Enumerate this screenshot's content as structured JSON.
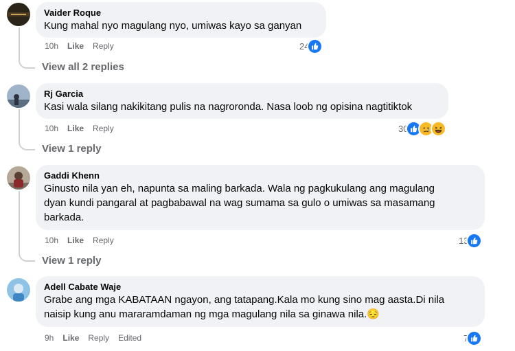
{
  "comments": [
    {
      "author": "Vaider Roque",
      "lines": [
        "Kung mahal nyo magulang nyo, umiwas kayo sa ganyan"
      ],
      "time": "10h",
      "like": "Like",
      "reply": "Reply",
      "reaction_count": "24",
      "reactions": [
        "like-icon"
      ],
      "view_replies": "View all 2 replies"
    },
    {
      "author": "Rj Garcia",
      "lines": [
        "Kasi wala silang nakikitang pulis na nagroronda. Nasa loob ng opisina nagtitiktok"
      ],
      "time": "10h",
      "like": "Like",
      "reply": "Reply",
      "reaction_count": "30",
      "reactions": [
        "like-icon",
        "sad-icon",
        "haha-icon"
      ],
      "view_replies": "View 1 reply"
    },
    {
      "author": "Gaddi Khenn",
      "lines": [
        "Ginusto nila yan eh, napunta sa maling barkada. Wala ng pagkukulang ang magulang",
        "dyan kundi pangaral at pagbabawal na wag sumama sa gulo o umiwas sa masamang",
        "barkada."
      ],
      "time": "10h",
      "like": "Like",
      "reply": "Reply",
      "reaction_count": "13",
      "reactions": [
        "like-icon"
      ],
      "view_replies": "View 1 reply"
    },
    {
      "author": "Adell Cabate Waje",
      "lines": [
        "Grabe ang mga KABATAAN ngayon, ang tatapang.Kala mo kung sino mag aasta.Di nila",
        "naisip kung anu mararamdaman ng mga magulang nila sa ginawa nila.😔"
      ],
      "time": "9h",
      "like": "Like",
      "reply": "Reply",
      "edited": "Edited",
      "reaction_count": "7",
      "reactions": [
        "like-icon"
      ]
    }
  ],
  "colors": {
    "bubble": "#f0f2f5",
    "meta": "#65676b",
    "like_blue": "#1877f2",
    "reaction_yellow": "#f7b928"
  }
}
